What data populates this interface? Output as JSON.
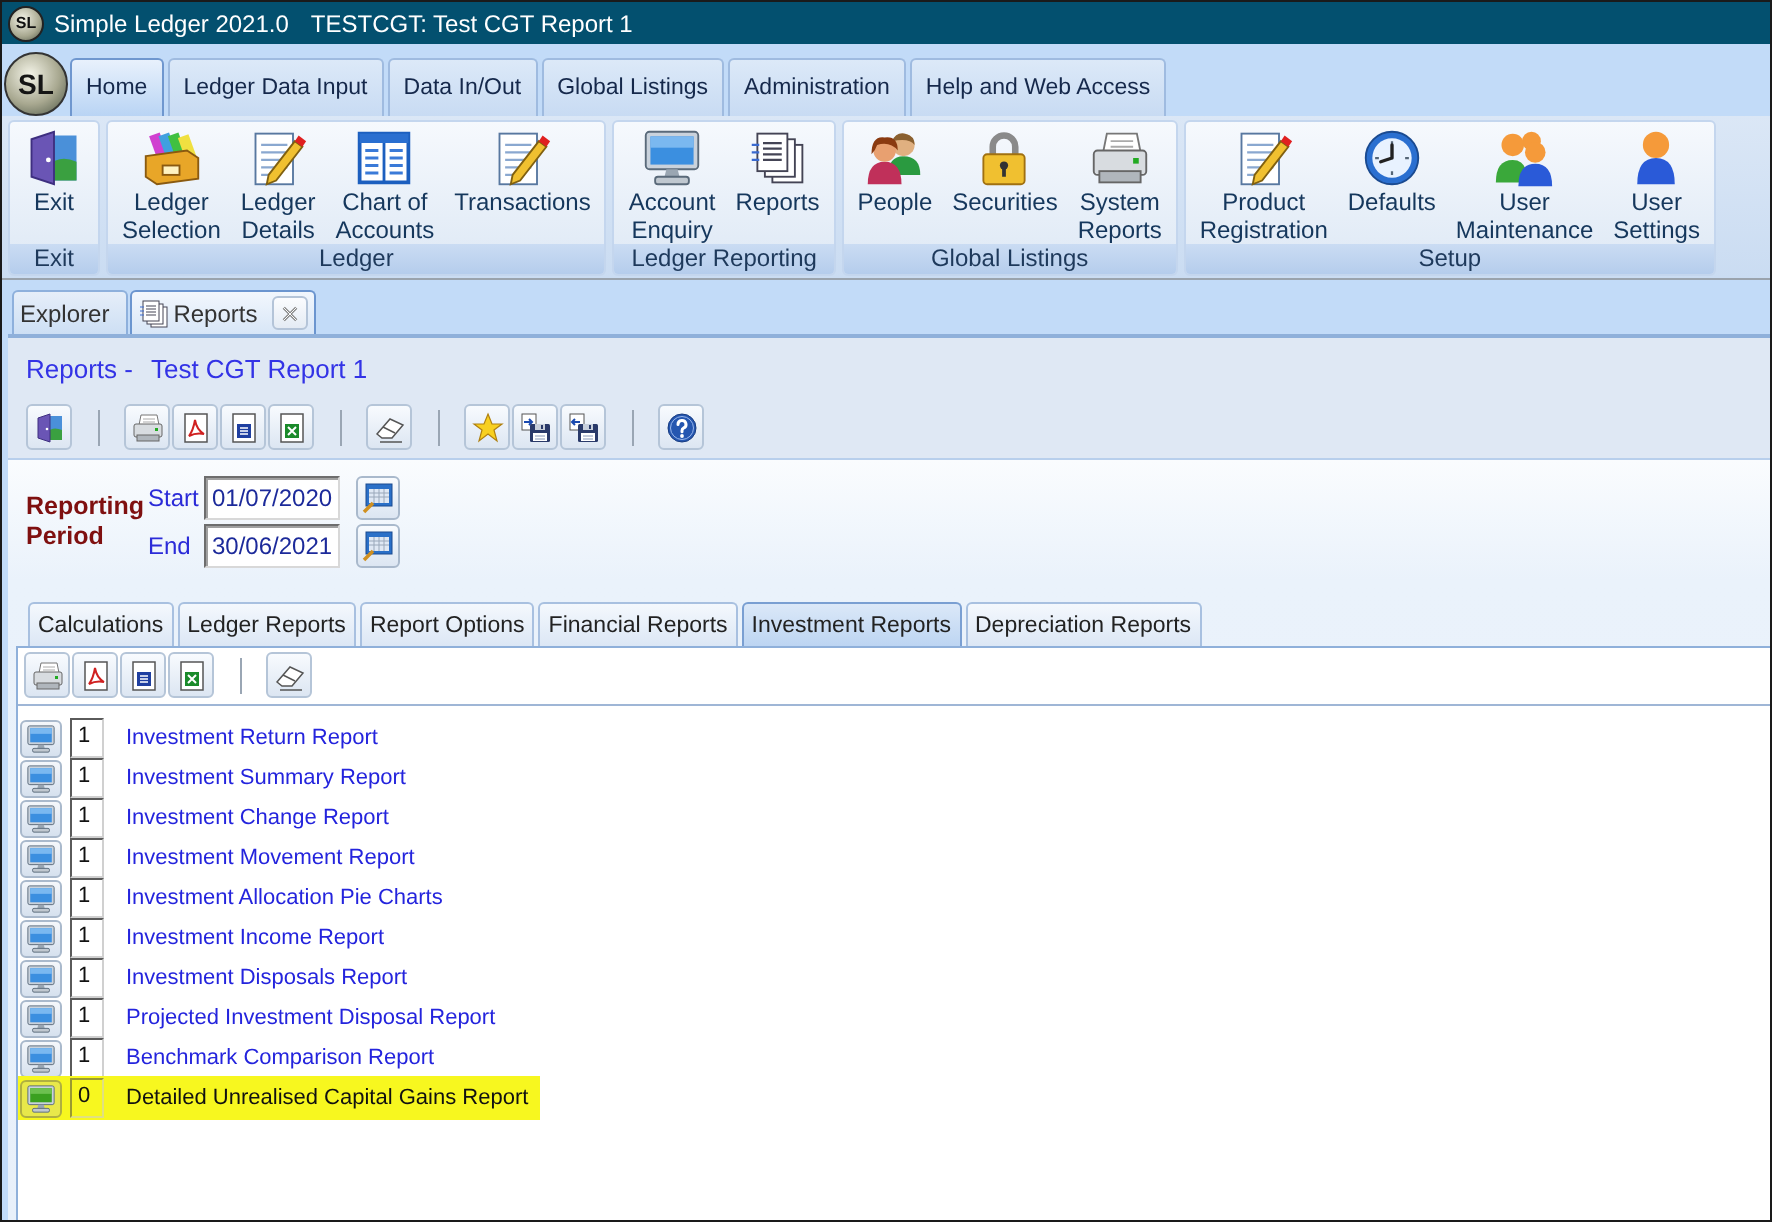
{
  "window": {
    "icon_text": "SL",
    "title": "Simple Ledger 2021.0",
    "document": "TESTCGT: Test CGT Report 1"
  },
  "app_button": {
    "text": "SL"
  },
  "menu_tabs": [
    {
      "label": "Home",
      "selected": true
    },
    {
      "label": "Ledger Data Input",
      "selected": false
    },
    {
      "label": "Data In/Out",
      "selected": false
    },
    {
      "label": "Global Listings",
      "selected": false
    },
    {
      "label": "Administration",
      "selected": false
    },
    {
      "label": "Help and Web Access",
      "selected": false
    }
  ],
  "ribbon": {
    "groups": [
      {
        "label": "Exit",
        "items": [
          "Exit"
        ]
      },
      {
        "label": "Ledger",
        "items": [
          "Ledger\nSelection",
          "Ledger\nDetails",
          "Chart of\nAccounts",
          "Transactions"
        ]
      },
      {
        "label": "Ledger Reporting",
        "items": [
          "Account\nEnquiry",
          "Reports"
        ]
      },
      {
        "label": "Global Listings",
        "items": [
          "People",
          "Securities",
          "System\nReports"
        ]
      },
      {
        "label": "Setup",
        "items": [
          "Product\nRegistration",
          "Defaults",
          "User\nMaintenance",
          "User\nSettings"
        ]
      }
    ]
  },
  "document_tabs": [
    {
      "label": "Explorer",
      "kind": "panel",
      "selected": false
    },
    {
      "label": "Reports",
      "kind": "document",
      "selected": true
    }
  ],
  "report": {
    "prefix": "Reports -",
    "title": "Test CGT Report 1"
  },
  "reporting_period": {
    "label": "Reporting\nPeriod",
    "start": {
      "label": "Start",
      "value": "01/07/2020"
    },
    "end": {
      "label": "End",
      "value": "30/06/2021"
    }
  },
  "report_tabs": [
    {
      "label": "Calculations",
      "selected": false
    },
    {
      "label": "Ledger Reports",
      "selected": false
    },
    {
      "label": "Report Options",
      "selected": false
    },
    {
      "label": "Financial Reports",
      "selected": false
    },
    {
      "label": "Investment Reports",
      "selected": true
    },
    {
      "label": "Depreciation Reports",
      "selected": false
    }
  ],
  "reports": [
    {
      "copies": "1",
      "name": "Investment Return Report",
      "selected": false
    },
    {
      "copies": "1",
      "name": "Investment Summary Report",
      "selected": false
    },
    {
      "copies": "1",
      "name": "Investment Change Report",
      "selected": false
    },
    {
      "copies": "1",
      "name": "Investment Movement Report",
      "selected": false
    },
    {
      "copies": "1",
      "name": "Investment Allocation Pie Charts",
      "selected": false
    },
    {
      "copies": "1",
      "name": "Investment Income Report",
      "selected": false
    },
    {
      "copies": "1",
      "name": "Investment Disposals Report",
      "selected": false
    },
    {
      "copies": "1",
      "name": "Projected Investment Disposal Report",
      "selected": false
    },
    {
      "copies": "1",
      "name": "Benchmark Comparison Report",
      "selected": false
    },
    {
      "copies": "0",
      "name": "Detailed Unrealised Capital Gains Report",
      "selected": true
    }
  ]
}
